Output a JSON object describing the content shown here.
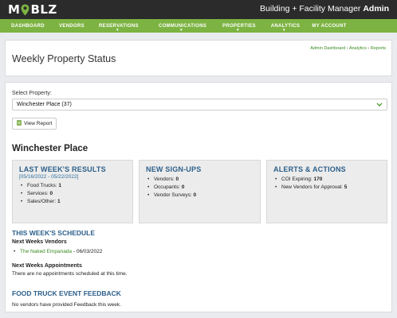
{
  "header": {
    "logo_left": "M",
    "logo_right": "BLZ",
    "app_title": "Building + Facility Manager",
    "user_role": "Admin"
  },
  "nav": {
    "items": [
      {
        "label": "DASHBOARD",
        "dropdown": false
      },
      {
        "label": "VENDORS",
        "dropdown": false
      },
      {
        "label": "RESERVATIONS",
        "dropdown": true
      },
      {
        "label": "COMMUNICATIONS",
        "dropdown": true
      },
      {
        "label": "PROPERTIES",
        "dropdown": true
      },
      {
        "label": "ANALYTICS",
        "dropdown": true
      },
      {
        "label": "MY ACCOUNT",
        "dropdown": false
      }
    ]
  },
  "page": {
    "title": "Weekly Property Status",
    "breadcrumb": {
      "items": [
        "Admin Dashboard",
        "Analytics",
        "Reports"
      ],
      "separator": " › "
    }
  },
  "form": {
    "select_label": "Select Property:",
    "selected_property": "Winchester Place (37)",
    "view_report_label": "View Report"
  },
  "property": {
    "name": "Winchester Place"
  },
  "panels": {
    "last_week": {
      "title": "LAST WEEK'S RESULTS",
      "range": "[05/16/2022 - 05/22/2022]",
      "items": [
        {
          "label": "Food Trucks:",
          "value": "1"
        },
        {
          "label": "Services:",
          "value": "0"
        },
        {
          "label": "Sales/Other:",
          "value": "1"
        }
      ]
    },
    "signups": {
      "title": "NEW SIGN-UPS",
      "items": [
        {
          "label": "Vendors:",
          "value": "0"
        },
        {
          "label": "Occupants:",
          "value": "0"
        },
        {
          "label": "Vendor Surveys:",
          "value": "0"
        }
      ]
    },
    "alerts": {
      "title": "ALERTS & ACTIONS",
      "items": [
        {
          "label": "COI Expiring:",
          "value": "170"
        },
        {
          "label": "New Vendors for Approval:",
          "value": "5"
        }
      ]
    }
  },
  "schedule": {
    "title": "THIS WEEK'S SCHEDULE",
    "vendors_title": "Next Weeks Vendors",
    "vendors": [
      {
        "name": "The Naked Empanada",
        "date": " - 06/03/2022"
      }
    ],
    "appointments_title": "Next Weeks Appointments",
    "appointments_text": "There are no appointments scheduled at this time."
  },
  "feedback": {
    "title": "FOOD TRUCK EVENT FEEDBACK",
    "text": "No vendors have provided Feedback this week."
  },
  "colors": {
    "topbar": "#2b2b2b",
    "nav": "#7cb342",
    "heading_blue": "#2c5f8a",
    "link_green": "#3a8a20"
  }
}
